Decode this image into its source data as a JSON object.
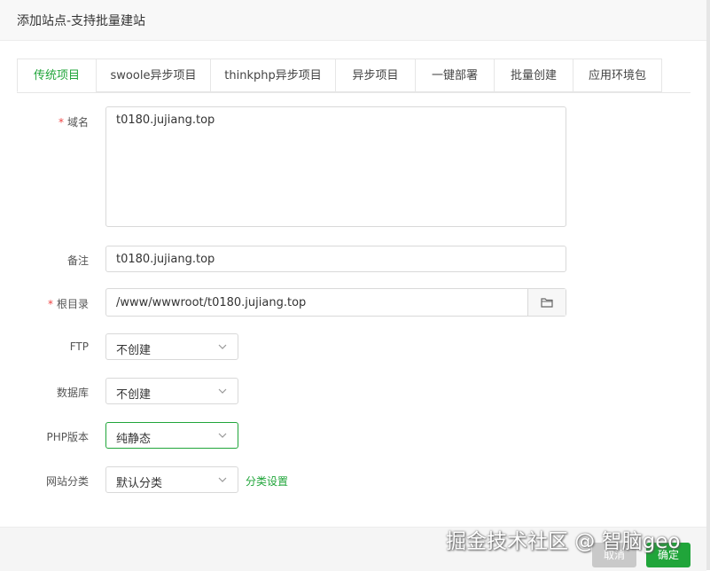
{
  "dialog": {
    "title": "添加站点-支持批量建站"
  },
  "tabs": [
    {
      "label": "传统项目",
      "active": true
    },
    {
      "label": "swoole异步项目"
    },
    {
      "label": "thinkphp异步项目"
    },
    {
      "label": "异步项目"
    },
    {
      "label": "一键部署"
    },
    {
      "label": "批量创建"
    },
    {
      "label": "应用环境包"
    }
  ],
  "form": {
    "domain": {
      "label": "域名",
      "required_mark": "*",
      "value": "t0180.jujiang.top"
    },
    "remark": {
      "label": "备注",
      "value": "t0180.jujiang.top"
    },
    "root": {
      "label": "根目录",
      "required_mark": "*",
      "value": "/www/wwwroot/t0180.jujiang.top",
      "icon": "folder-icon"
    },
    "ftp": {
      "label": "FTP",
      "value": "不创建"
    },
    "database": {
      "label": "数据库",
      "value": "不创建"
    },
    "php": {
      "label": "PHP版本",
      "value": "纯静态"
    },
    "category": {
      "label": "网站分类",
      "value": "默认分类",
      "link": "分类设置"
    }
  },
  "footer": {
    "cancel_label": "取消",
    "ok_label": "确定"
  },
  "watermark": "掘金技术社区 @ 智脑geo",
  "colors": {
    "accent": "#20a53a",
    "required": "#ef4444"
  }
}
